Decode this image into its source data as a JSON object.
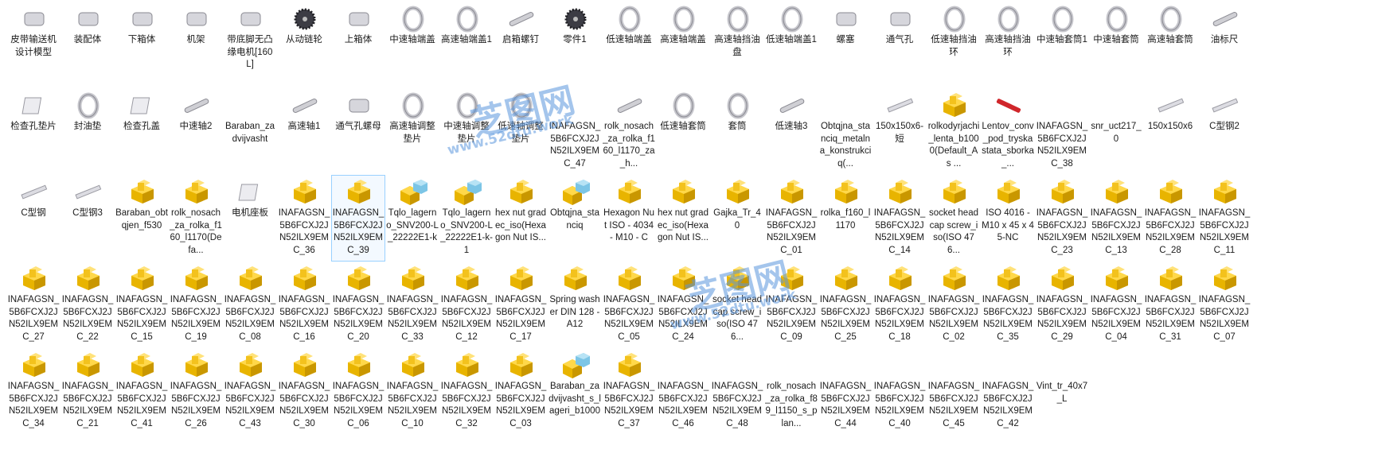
{
  "window": {
    "title": ""
  },
  "watermark": {
    "brand": "芝图网",
    "url": "www.52dtu.work"
  },
  "files": [
    {
      "label": "皮带输送机设计模型",
      "icon": "conveyor-part-icon"
    },
    {
      "label": "装配体",
      "icon": "assembly-part-icon"
    },
    {
      "label": "下箱体",
      "icon": "housing-part-icon"
    },
    {
      "label": "机架",
      "icon": "frame-part-icon"
    },
    {
      "label": "带底脚无凸缘电机[160L]",
      "icon": "motor-part-icon"
    },
    {
      "label": "从动链轮",
      "icon": "sprocket-part-icon"
    },
    {
      "label": "上箱体",
      "icon": "housing-part-icon"
    },
    {
      "label": "中速轴端盖",
      "icon": "ring-part-icon"
    },
    {
      "label": "高速轴端盖1",
      "icon": "ring-part-icon"
    },
    {
      "label": "启箱螺钉",
      "icon": "screw-part-icon"
    },
    {
      "label": "零件1",
      "icon": "gear-part-icon"
    },
    {
      "label": "低速轴端盖",
      "icon": "ring-part-icon"
    },
    {
      "label": "高速轴端盖",
      "icon": "ring-part-icon"
    },
    {
      "label": "高速轴挡油盘",
      "icon": "ring-part-icon"
    },
    {
      "label": "低速轴端盖1",
      "icon": "ring-part-icon"
    },
    {
      "label": "螺塞",
      "icon": "plug-part-icon"
    },
    {
      "label": "通气孔",
      "icon": "vent-part-icon"
    },
    {
      "label": "低速轴挡油环",
      "icon": "ring-part-icon"
    },
    {
      "label": "高速轴挡油环",
      "icon": "ring-part-icon"
    },
    {
      "label": "中速轴套筒1",
      "icon": "ring-part-icon"
    },
    {
      "label": "中速轴套筒",
      "icon": "ring-part-icon"
    },
    {
      "label": "高速轴套筒",
      "icon": "ring-part-icon"
    },
    {
      "label": "油标尺",
      "icon": "dipstick-part-icon"
    },
    {
      "label": "检查孔垫片",
      "icon": "gasket-part-icon"
    },
    {
      "label": "封油垫",
      "icon": "ring-part-icon"
    },
    {
      "label": "检查孔盖",
      "icon": "plate-part-icon"
    },
    {
      "label": "中速轴2",
      "icon": "shaft-part-icon"
    },
    {
      "label": "Baraban_zadvijvasht",
      "icon": "blank-part-icon"
    },
    {
      "label": "高速轴1",
      "icon": "shaft-part-icon"
    },
    {
      "label": "通气孔螺母",
      "icon": "nut-part-icon"
    },
    {
      "label": "高速轴调整垫片",
      "icon": "ring-part-icon"
    },
    {
      "label": "中速轴调整垫片",
      "icon": "ring-part-icon"
    },
    {
      "label": "低速轴调整垫片",
      "icon": "ring-part-icon"
    },
    {
      "label": "INAFAGSN_5B6FCXJ2JN52ILX9EMC_47",
      "icon": "blank-part-icon"
    },
    {
      "label": "rolk_nosach_za_rolka_f160_l1170_za_h...",
      "icon": "rod-part-icon"
    },
    {
      "label": "低速轴套筒",
      "icon": "ring-part-icon"
    },
    {
      "label": "套筒",
      "icon": "ring-part-icon"
    },
    {
      "label": "低速轴3",
      "icon": "shaft-part-icon"
    },
    {
      "label": "Obtqjna_stanciq_metalna_konstrukciq(...",
      "icon": "blank-part-icon"
    },
    {
      "label": "150x150x6-短",
      "icon": "beam-part-icon"
    },
    {
      "label": "rolkodyrjachi_lenta_b1000(Default_As ...",
      "icon": "solidworks-part-icon"
    },
    {
      "label": "Lentov_conv_pod_tryskastata_sborka_...",
      "icon": "red-rod-part-icon"
    },
    {
      "label": "INAFAGSN_5B6FCXJ2JN52ILX9EMC_38",
      "icon": "blank-part-icon"
    },
    {
      "label": "snr_uct217_0",
      "icon": "blank-part-icon"
    },
    {
      "label": "150x150x6",
      "icon": "thin-line-part-icon"
    },
    {
      "label": "C型钢2",
      "icon": "beam-part-icon"
    },
    {
      "label": "C型钢",
      "icon": "beam-part-icon"
    },
    {
      "label": "C型钢3",
      "icon": "beam-part-icon"
    },
    {
      "label": "Baraban_obtqjen_f530",
      "icon": "solidworks-part-icon"
    },
    {
      "label": "rolk_nosach_za_rolka_f160_l1170(Defa...",
      "icon": "solidworks-part-icon"
    },
    {
      "label": "电机座板",
      "icon": "plate-part-icon"
    },
    {
      "label": "INAFAGSN_5B6FCXJ2JN52ILX9EMC_36",
      "icon": "solidworks-part-icon"
    },
    {
      "label": "INAFAGSN_5B6FCXJ2JN52ILX9EMC_39",
      "icon": "solidworks-part-icon",
      "selected": true
    },
    {
      "label": "Tqlo_lagerno_SNV200-L_22222E1-k",
      "icon": "solidworks-assembly-icon"
    },
    {
      "label": "Tqlo_lagerno_SNV200-L_22222E1-k-1",
      "icon": "solidworks-assembly-icon"
    },
    {
      "label": "hex nut gradec_iso(Hexagon Nut IS...",
      "icon": "solidworks-part-icon"
    },
    {
      "label": "Obtqjna_stanciq",
      "icon": "solidworks-assembly-icon"
    },
    {
      "label": "Hexagon Nut ISO - 4034 - M10 - C",
      "icon": "solidworks-part-icon"
    },
    {
      "label": "hex nut gradec_iso(Hexagon Nut IS...",
      "icon": "solidworks-part-icon"
    },
    {
      "label": "Gajka_Tr_40",
      "icon": "solidworks-part-icon"
    },
    {
      "label": "INAFAGSN_5B6FCXJ2JN52ILX9EMC_01",
      "icon": "solidworks-part-icon"
    },
    {
      "label": "rolka_f160_l1170",
      "icon": "solidworks-part-icon"
    },
    {
      "label": "INAFAGSN_5B6FCXJ2JN52ILX9EMC_14",
      "icon": "solidworks-part-icon"
    },
    {
      "label": "socket head cap screw_iso(ISO 476...",
      "icon": "solidworks-part-icon"
    },
    {
      "label": "ISO 4016 - M10 x 45 x 45-NC",
      "icon": "solidworks-part-icon"
    },
    {
      "label": "INAFAGSN_5B6FCXJ2JN52ILX9EMC_23",
      "icon": "solidworks-part-icon"
    },
    {
      "label": "INAFAGSN_5B6FCXJ2JN52ILX9EMC_13",
      "icon": "solidworks-part-icon"
    },
    {
      "label": "INAFAGSN_5B6FCXJ2JN52ILX9EMC_28",
      "icon": "solidworks-part-icon"
    },
    {
      "label": "INAFAGSN_5B6FCXJ2JN52ILX9EMC_11",
      "icon": "solidworks-part-icon"
    },
    {
      "label": "INAFAGSN_5B6FCXJ2JN52ILX9EMC_27",
      "icon": "solidworks-part-icon"
    },
    {
      "label": "INAFAGSN_5B6FCXJ2JN52ILX9EMC_22",
      "icon": "solidworks-part-icon"
    },
    {
      "label": "INAFAGSN_5B6FCXJ2JN52ILX9EMC_15",
      "icon": "solidworks-part-icon"
    },
    {
      "label": "INAFAGSN_5B6FCXJ2JN52ILX9EMC_19",
      "icon": "solidworks-part-icon"
    },
    {
      "label": "INAFAGSN_5B6FCXJ2JN52ILX9EMC_08",
      "icon": "solidworks-part-icon"
    },
    {
      "label": "INAFAGSN_5B6FCXJ2JN52ILX9EMC_16",
      "icon": "solidworks-part-icon"
    },
    {
      "label": "INAFAGSN_5B6FCXJ2JN52ILX9EMC_20",
      "icon": "solidworks-part-icon"
    },
    {
      "label": "INAFAGSN_5B6FCXJ2JN52ILX9EMC_33",
      "icon": "solidworks-part-icon"
    },
    {
      "label": "INAFAGSN_5B6FCXJ2JN52ILX9EMC_12",
      "icon": "solidworks-part-icon"
    },
    {
      "label": "INAFAGSN_5B6FCXJ2JN52ILX9EMC_17",
      "icon": "solidworks-part-icon"
    },
    {
      "label": "Spring washer DIN 128 - A12",
      "icon": "solidworks-part-icon"
    },
    {
      "label": "INAFAGSN_5B6FCXJ2JN52ILX9EMC_05",
      "icon": "solidworks-part-icon"
    },
    {
      "label": "INAFAGSN_5B6FCXJ2JN52ILX9EMC_24",
      "icon": "solidworks-part-icon"
    },
    {
      "label": "socket head cap screw_iso(ISO 476...",
      "icon": "solidworks-part-icon"
    },
    {
      "label": "INAFAGSN_5B6FCXJ2JN52ILX9EMC_09",
      "icon": "solidworks-part-icon"
    },
    {
      "label": "INAFAGSN_5B6FCXJ2JN52ILX9EMC_25",
      "icon": "solidworks-part-icon"
    },
    {
      "label": "INAFAGSN_5B6FCXJ2JN52ILX9EMC_18",
      "icon": "solidworks-part-icon"
    },
    {
      "label": "INAFAGSN_5B6FCXJ2JN52ILX9EMC_02",
      "icon": "solidworks-part-icon"
    },
    {
      "label": "INAFAGSN_5B6FCXJ2JN52ILX9EMC_35",
      "icon": "solidworks-part-icon"
    },
    {
      "label": "INAFAGSN_5B6FCXJ2JN52ILX9EMC_29",
      "icon": "solidworks-part-icon"
    },
    {
      "label": "INAFAGSN_5B6FCXJ2JN52ILX9EMC_04",
      "icon": "solidworks-part-icon"
    },
    {
      "label": "INAFAGSN_5B6FCXJ2JN52ILX9EMC_31",
      "icon": "solidworks-part-icon"
    },
    {
      "label": "INAFAGSN_5B6FCXJ2JN52ILX9EMC_07",
      "icon": "solidworks-part-icon"
    },
    {
      "label": "INAFAGSN_5B6FCXJ2JN52ILX9EMC_34",
      "icon": "solidworks-part-icon"
    },
    {
      "label": "INAFAGSN_5B6FCXJ2JN52ILX9EMC_21",
      "icon": "solidworks-part-icon"
    },
    {
      "label": "INAFAGSN_5B6FCXJ2JN52ILX9EMC_41",
      "icon": "solidworks-part-icon"
    },
    {
      "label": "INAFAGSN_5B6FCXJ2JN52ILX9EMC_26",
      "icon": "solidworks-part-icon"
    },
    {
      "label": "INAFAGSN_5B6FCXJ2JN52ILX9EMC_43",
      "icon": "solidworks-part-icon"
    },
    {
      "label": "INAFAGSN_5B6FCXJ2JN52ILX9EMC_30",
      "icon": "solidworks-part-icon"
    },
    {
      "label": "INAFAGSN_5B6FCXJ2JN52ILX9EMC_06",
      "icon": "solidworks-part-icon"
    },
    {
      "label": "INAFAGSN_5B6FCXJ2JN52ILX9EMC_10",
      "icon": "solidworks-part-icon"
    },
    {
      "label": "INAFAGSN_5B6FCXJ2JN52ILX9EMC_32",
      "icon": "solidworks-part-icon"
    },
    {
      "label": "INAFAGSN_5B6FCXJ2JN52ILX9EMC_03",
      "icon": "solidworks-part-icon"
    },
    {
      "label": "Baraban_zadvijvasht_s_lageri_b1000",
      "icon": "solidworks-assembly-icon"
    },
    {
      "label": "INAFAGSN_5B6FCXJ2JN52ILX9EMC_37",
      "icon": "solidworks-part-icon"
    },
    {
      "label": "INAFAGSN_5B6FCXJ2JN52ILX9EMC_46",
      "icon": "blank-part-icon"
    },
    {
      "label": "INAFAGSN_5B6FCXJ2JN52ILX9EMC_48",
      "icon": "blank-part-icon"
    },
    {
      "label": "rolk_nosach_za_rolka_f89_l1150_s_plan...",
      "icon": "blank-part-icon"
    },
    {
      "label": "INAFAGSN_5B6FCXJ2JN52ILX9EMC_44",
      "icon": "blank-part-icon"
    },
    {
      "label": "INAFAGSN_5B6FCXJ2JN52ILX9EMC_40",
      "icon": "blank-part-icon"
    },
    {
      "label": "INAFAGSN_5B6FCXJ2JN52ILX9EMC_45",
      "icon": "blank-part-icon"
    },
    {
      "label": "INAFAGSN_5B6FCXJ2JN52ILX9EMC_42",
      "icon": "blank-part-icon"
    },
    {
      "label": "Vint_tr_40x7_L",
      "icon": "blank-part-icon"
    }
  ]
}
